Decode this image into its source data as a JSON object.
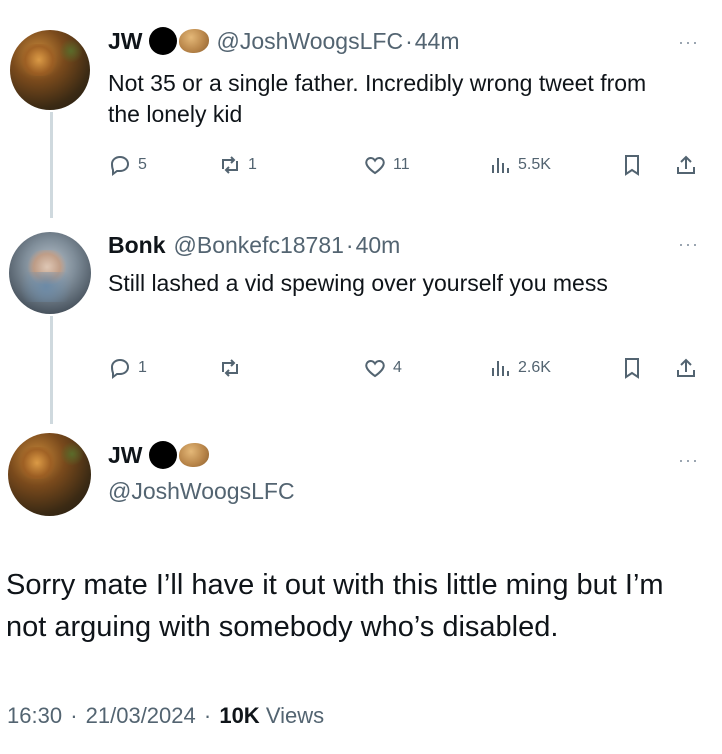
{
  "tweets": [
    {
      "name": "JW",
      "handle": "@JoshWoogsLFC",
      "time": "44m",
      "text": "Not 35 or a single father.  Incredibly wrong tweet from the lonely kid",
      "replies": "5",
      "reposts": "1",
      "likes": "11",
      "views": "5.5K",
      "more": "···"
    },
    {
      "name": "Bonk",
      "handle": "@Bonkefc18781",
      "time": "40m",
      "text": "Still lashed a vid spewing over yourself you mess",
      "replies": "1",
      "reposts": "",
      "likes": "4",
      "views": "2.6K",
      "more": "···"
    }
  ],
  "main_tweet": {
    "name": "JW",
    "handle": "@JoshWoogsLFC",
    "text": "Sorry mate I’ll have it out with this little ming but I’m not arguing with somebody who’s disabled.",
    "time": "16:30",
    "date": "21/03/2024",
    "views_count": "10K",
    "views_label": "Views",
    "more": "···"
  },
  "colors": {
    "muted": "#536471",
    "text": "#0f1419",
    "thread_line": "#cfd9de"
  },
  "icons": [
    "reply-icon",
    "repost-icon",
    "like-icon",
    "views-icon",
    "bookmark-icon",
    "share-icon"
  ]
}
